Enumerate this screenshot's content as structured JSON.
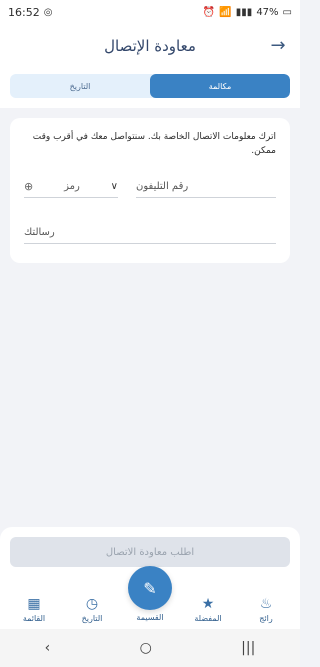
{
  "status": {
    "time": "16:52",
    "battery": "47%"
  },
  "header": {
    "title": "معاودة الإتصال"
  },
  "tabs": [
    {
      "label": "مكالمة",
      "active": true
    },
    {
      "label": "التاريخ",
      "active": false
    }
  ],
  "form": {
    "info_text": "اترك معلومات الاتصال الخاصة بك. سنتواصل معك في أقرب وقت ممكن.",
    "phone_placeholder": "رقم التليفون",
    "code_placeholder": "رمز",
    "message_placeholder": "رسالتك"
  },
  "cta": {
    "label": "اطلب معاودة الاتصال"
  },
  "nav": {
    "items": [
      {
        "label": "القائمة",
        "icon": "grid-icon"
      },
      {
        "label": "التاريخ",
        "icon": "clock-icon"
      },
      {
        "label": "القسيمة",
        "icon": "ticket-icon"
      },
      {
        "label": "المفضلة",
        "icon": "star-icon"
      },
      {
        "label": "رائج",
        "icon": "fire-icon"
      }
    ]
  },
  "colors": {
    "accent": "#3a82c4",
    "text": "#2b2b2b"
  }
}
